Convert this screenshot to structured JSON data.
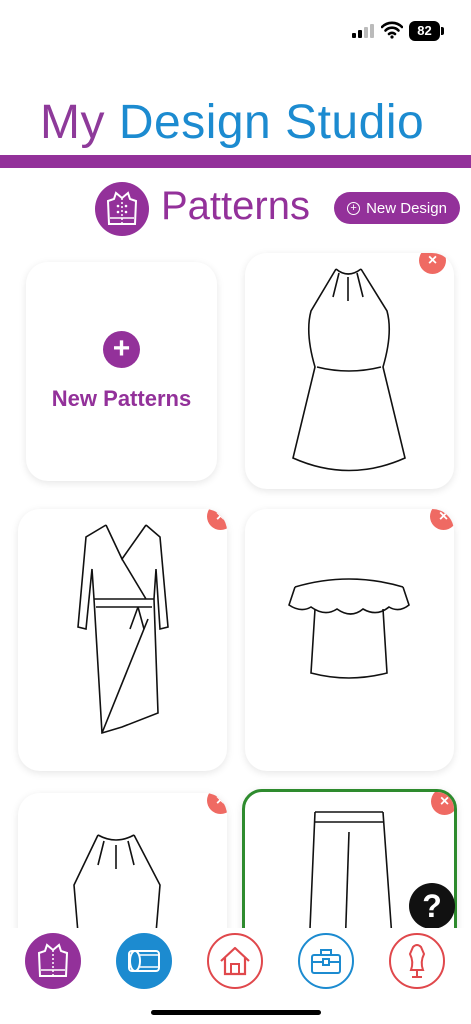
{
  "status_bar": {
    "battery": "82"
  },
  "header": {
    "title_part1": "My ",
    "title_part2": "Design Studio"
  },
  "section": {
    "title": "Patterns",
    "new_design_label": "New Design"
  },
  "grid": {
    "new_card_label": "New Patterns",
    "remove_glyph": "×"
  },
  "help": {
    "label": "?"
  },
  "colors": {
    "purple": "#93319a",
    "blue": "#1c8bd0",
    "red": "#e0484c",
    "remove": "#ef6a63",
    "selected": "#2e8b2e"
  },
  "icons": [
    "dress-form-icon",
    "fabric-roll-icon",
    "home-icon",
    "toolbox-icon",
    "mannequin-icon"
  ]
}
